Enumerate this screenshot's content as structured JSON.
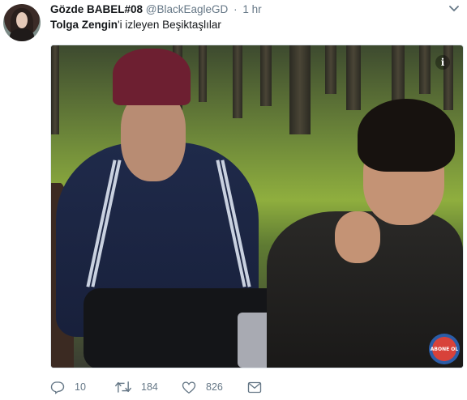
{
  "tweet": {
    "author_name": "Gözde BABEL#08",
    "author_handle": "@BlackEagleGD",
    "separator": "·",
    "time": "1 hr",
    "mention": "Tolga Zengin",
    "text_rest": "'i izleyen Beşiktaşlılar",
    "avatar_icon": "user-avatar",
    "caret_icon": "chevron-down-icon"
  },
  "media": {
    "info_icon": "info-icon",
    "info_glyph": "i",
    "watermark_text": "ABONE OL"
  },
  "actions": {
    "reply_count": "10",
    "retweet_count": "184",
    "like_count": "826",
    "reply_icon": "reply-icon",
    "retweet_icon": "retweet-icon",
    "like_icon": "heart-icon",
    "dm_icon": "envelope-icon"
  },
  "colors": {
    "muted": "#657786",
    "text": "#14171a"
  }
}
